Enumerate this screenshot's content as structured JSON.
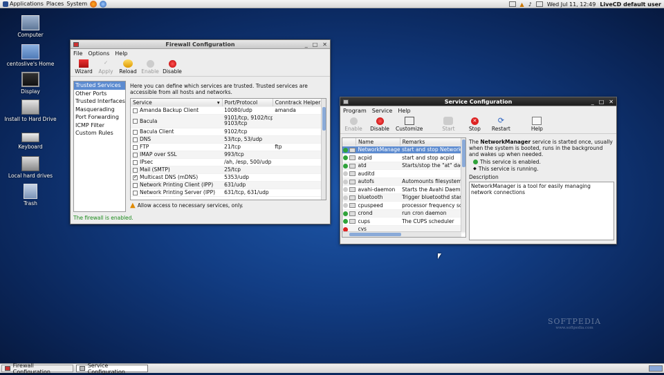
{
  "topbar": {
    "menus": [
      "Applications",
      "Places",
      "System"
    ],
    "datetime": "Wed Jul 11, 12:49",
    "user": "LiveCD default user"
  },
  "desktop": {
    "icons": [
      "Computer",
      "centoslive's Home",
      "Display",
      "Install to Hard Drive",
      "Keyboard",
      "Local hard drives",
      "Trash"
    ]
  },
  "firewall": {
    "title": "Firewall Configuration",
    "menu": [
      "File",
      "Options",
      "Help"
    ],
    "toolbar": [
      "Wizard",
      "Apply",
      "Reload",
      "Enable",
      "Disable"
    ],
    "sidebar": [
      "Trusted Services",
      "Other Ports",
      "Trusted Interfaces",
      "Masquerading",
      "Port Forwarding",
      "ICMP Filter",
      "Custom Rules"
    ],
    "description": "Here you can define which services are trusted. Trusted services are accessible from all hosts and networks.",
    "columns": [
      "Service",
      "Port/Protocol",
      "Conntrack Helper"
    ],
    "rows": [
      {
        "service": "Amanda Backup Client",
        "port": "10080/udp",
        "helper": "amanda",
        "checked": false
      },
      {
        "service": "Bacula",
        "port": "9101/tcp, 9102/tcp,",
        "port2": "9103/tcp",
        "helper": "",
        "checked": false
      },
      {
        "service": "Bacula Client",
        "port": "9102/tcp",
        "helper": "",
        "checked": false
      },
      {
        "service": "DNS",
        "port": "53/tcp, 53/udp",
        "helper": "",
        "checked": false
      },
      {
        "service": "FTP",
        "port": "21/tcp",
        "helper": "ftp",
        "checked": false
      },
      {
        "service": "IMAP over SSL",
        "port": "993/tcp",
        "helper": "",
        "checked": false
      },
      {
        "service": "IPsec",
        "port": "/ah, /esp, 500/udp",
        "helper": "",
        "checked": false
      },
      {
        "service": "Mail (SMTP)",
        "port": "25/tcp",
        "helper": "",
        "checked": false
      },
      {
        "service": "Multicast DNS (mDNS)",
        "port": "5353/udp",
        "helper": "",
        "checked": true
      },
      {
        "service": "Network Printing Client (IPP)",
        "port": "631/udp",
        "helper": "",
        "checked": false
      },
      {
        "service": "Network Printing Server (IPP)",
        "port": "631/tcp, 631/udp",
        "helper": "",
        "checked": false
      }
    ],
    "warning": "Allow access to necessary services, only.",
    "status": "The firewall is enabled."
  },
  "service": {
    "title": "Service Configuration",
    "menu": [
      "Program",
      "Service",
      "Help"
    ],
    "toolbar": [
      "Enable",
      "Disable",
      "Customize",
      "Start",
      "Stop",
      "Restart",
      "Help"
    ],
    "columns": [
      "Name",
      "Remarks"
    ],
    "rows": [
      {
        "name": "NetworkManager",
        "remark": "start and stop NetworkMa",
        "state": "green",
        "selected": true
      },
      {
        "name": "acpid",
        "remark": "start and stop acpid",
        "state": "green"
      },
      {
        "name": "atd",
        "remark": "Starts/stop the \"at\" daemo",
        "state": "green"
      },
      {
        "name": "auditd",
        "remark": "",
        "state": "none"
      },
      {
        "name": "autofs",
        "remark": "Automounts filesystems o",
        "state": "none"
      },
      {
        "name": "avahi-daemon",
        "remark": "Starts the Avahi Daemon",
        "state": "none"
      },
      {
        "name": "bluetooth",
        "remark": "Trigger bluetoothd start-u",
        "state": "none"
      },
      {
        "name": "cpuspeed",
        "remark": "processor frequency scali",
        "state": "none"
      },
      {
        "name": "crond",
        "remark": "run cron daemon",
        "state": "green"
      },
      {
        "name": "cups",
        "remark": "The CUPS scheduler",
        "state": "green"
      },
      {
        "name": "cvs",
        "remark": "",
        "state": "red"
      }
    ],
    "info_prefix": "The ",
    "info_name": "NetworkManager",
    "info_suffix": " service is started once, usually when the system is booted, runs in the background and wakes up when needed.",
    "enabled": "This service is enabled.",
    "running": "This service is running.",
    "desc_label": "Description",
    "desc": "NetworkManager is a tool for easily managing network connections"
  },
  "taskbar": [
    "Firewall Configuration",
    "Service Configuration"
  ],
  "watermark": "SOFTPEDIA",
  "watermark_sub": "www.softpedia.com"
}
